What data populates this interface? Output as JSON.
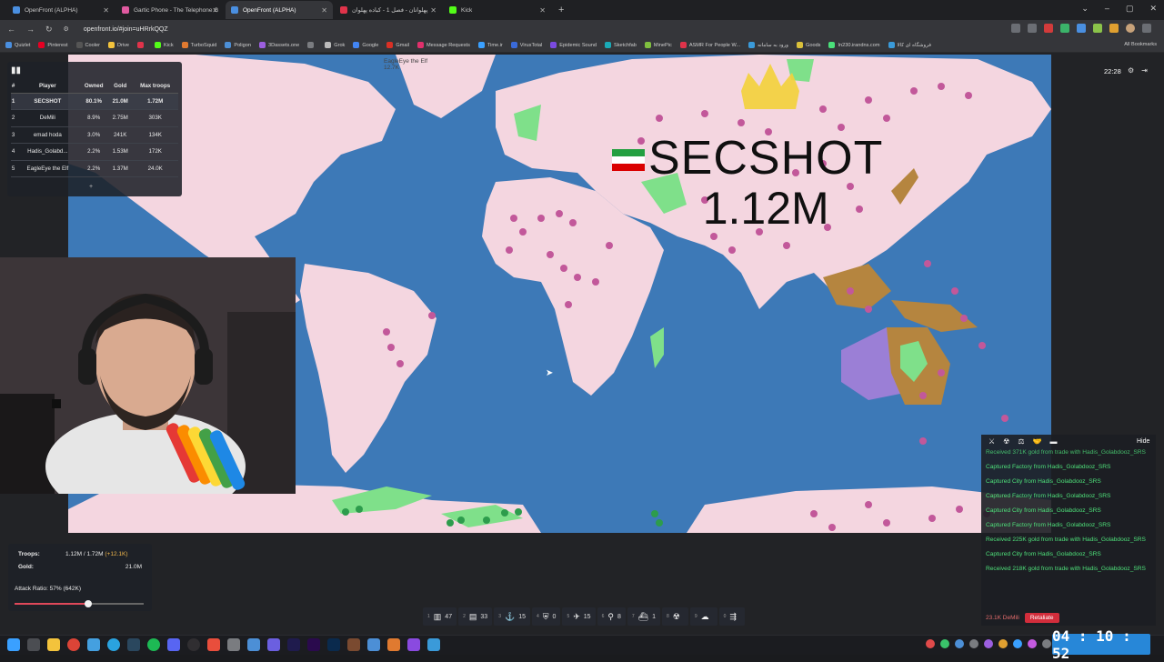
{
  "browser": {
    "tabs": [
      {
        "title": "OpenFront (ALPHA)",
        "color": "#4a8fe0",
        "active": false
      },
      {
        "title": "Gartic Phone - The Telephone G",
        "color": "#e05aa0",
        "active": false
      },
      {
        "title": "OpenFront (ALPHA)",
        "color": "#4a8fe0",
        "active": true
      },
      {
        "title": "پهلوانان - فصل 1 - کباده پهلوان",
        "color": "#e0334a",
        "active": false
      },
      {
        "title": "Kick",
        "color": "#53fc18",
        "active": false
      }
    ],
    "url": "openfront.io/#join=uHRrkQQZ",
    "bookmarks": [
      "Quizlet",
      "Pinterest",
      "Cooler",
      "Drive",
      "",
      "Kick",
      "TurboSquid",
      "Poligon",
      "3Dassets.one",
      "",
      "Grok",
      "Google",
      "Gmail",
      "Message Requests",
      "Time.ir",
      "VirusTotal",
      "Epidemic Sound",
      "Sketchfab",
      "MinePic",
      "ASMR For People W...",
      "ورود به سامانه",
      "Goods",
      "In230.irandns.com",
      "فروشگاه ای کالا"
    ],
    "all_bookmarks": "All Bookmarks"
  },
  "game": {
    "clock": "22:28",
    "map_label_small": "EagleEye the Elf",
    "map_label_small_value": "12.7K",
    "player_label": {
      "name": "SECSHOT",
      "troops": "1.12M"
    },
    "leaderboard": {
      "headers": [
        "#",
        "Player",
        "Owned",
        "Gold",
        "Max troops"
      ],
      "rows": [
        {
          "rank": "1",
          "player": "SECSHOT",
          "owned": "80.1%",
          "gold": "21.0M",
          "troops": "1.72M"
        },
        {
          "rank": "2",
          "player": "DeMili",
          "owned": "8.9%",
          "gold": "2.75M",
          "troops": "303K"
        },
        {
          "rank": "3",
          "player": "emad hoda",
          "owned": "3.0%",
          "gold": "241K",
          "troops": "134K"
        },
        {
          "rank": "4",
          "player": "Hadis_Golabd...",
          "owned": "2.2%",
          "gold": "1.53M",
          "troops": "172K"
        },
        {
          "rank": "5",
          "player": "EagleEye the Elf",
          "owned": "2.2%",
          "gold": "1.37M",
          "troops": "24.0K"
        }
      ],
      "more": "+"
    },
    "stats": {
      "troops_label": "Troops:",
      "troops_value": "1.12M / 1.72M",
      "troops_delta": "(+12.1K)",
      "gold_label": "Gold:",
      "gold_value": "21.0M",
      "attack_ratio": "Attack Ratio: 57% (642K)",
      "attack_ratio_fraction": 0.57
    },
    "build_bar": [
      {
        "key": "1",
        "icon": "city-icon",
        "glyph": "▥",
        "count": "47"
      },
      {
        "key": "2",
        "icon": "factory-icon",
        "glyph": "▤",
        "count": "33"
      },
      {
        "key": "3",
        "icon": "port-icon",
        "glyph": "⚓",
        "count": "15"
      },
      {
        "key": "4",
        "icon": "defense-post-icon",
        "glyph": "⛨",
        "count": "0"
      },
      {
        "key": "5",
        "icon": "missile-silo-icon",
        "glyph": "✈",
        "count": "15"
      },
      {
        "key": "6",
        "icon": "sam-launcher-icon",
        "glyph": "⚲",
        "count": "8"
      },
      {
        "key": "7",
        "icon": "warship-icon",
        "glyph": "⛴",
        "count": "1"
      },
      {
        "key": "8",
        "icon": "atom-bomb-icon",
        "glyph": "☢",
        "count": ""
      },
      {
        "key": "9",
        "icon": "hydrogen-bomb-icon",
        "glyph": "☁",
        "count": ""
      },
      {
        "key": "0",
        "icon": "mirv-icon",
        "glyph": "⇶",
        "count": ""
      }
    ],
    "events": {
      "hide_label": "Hide",
      "items": [
        "Received 371K gold from trade with Hadis_Golabdooz_SRS",
        "Captured Factory from Hadis_Golabdooz_SRS",
        "Captured City from Hadis_Golabdooz_SRS",
        "Captured Factory from Hadis_Golabdooz_SRS",
        "Captured City from Hadis_Golabdooz_SRS",
        "Captured Factory from Hadis_Golabdooz_SRS",
        "Received 225K gold from trade with Hadis_Golabdooz_SRS",
        "Captured City from Hadis_Golabdooz_SRS",
        "Received 218K gold from trade with Hadis_Golabdooz_SRS"
      ],
      "incoming": "23.1K DeMili",
      "retaliate_label": "Retaliate"
    }
  },
  "overlay_timer": "04 : 10 : 52",
  "colors": {
    "ocean": "#3d79b7",
    "player_territory": "#f4d6e0",
    "enemy_green": "#7fe08a",
    "enemy_brown": "#b5853f",
    "enemy_purple": "#9b7fd6",
    "events_text": "#4ee07a",
    "retaliate": "#d22d3b",
    "timer_bg": "#2787d8"
  }
}
